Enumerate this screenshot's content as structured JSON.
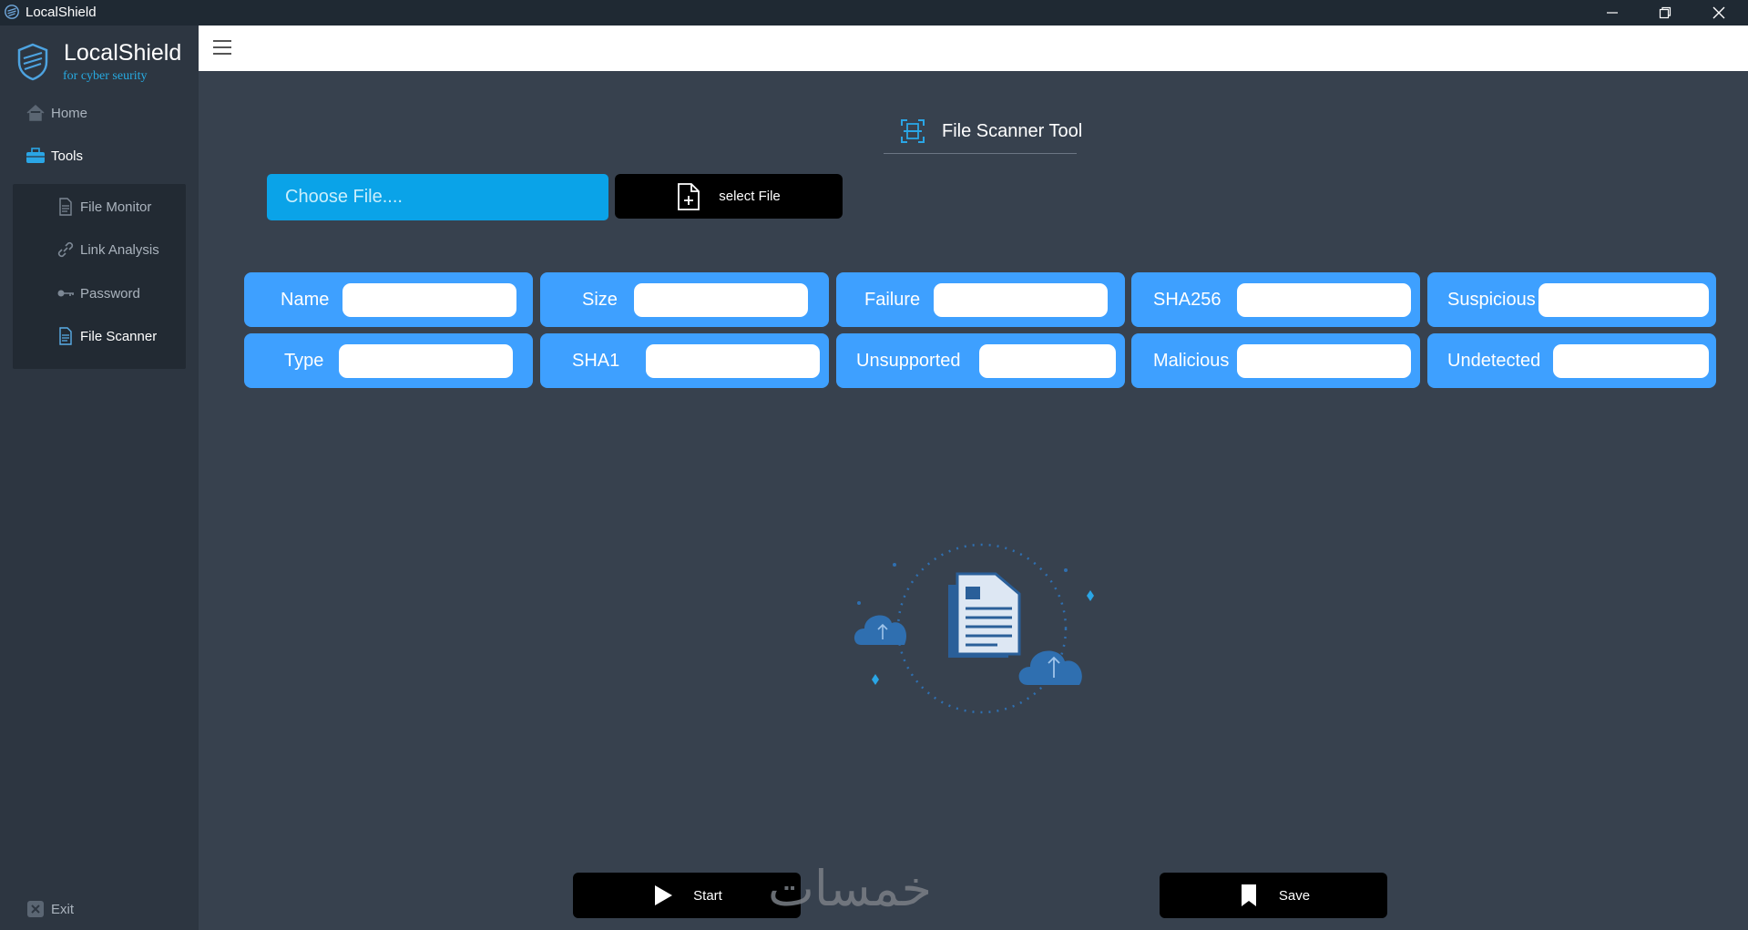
{
  "window": {
    "title": "LocalShield"
  },
  "sidebar": {
    "brand": "LocalShield",
    "tagline": "for cyber seurity",
    "home": "Home",
    "tools": "Tools",
    "tools_items": [
      "File Monitor",
      "Link Analysis",
      "Password",
      "File Scanner"
    ],
    "active_item": "File Scanner",
    "exit": "Exit"
  },
  "main": {
    "title": "File Scanner Tool",
    "choose_placeholder": "Choose File....",
    "select_button": "select File",
    "fields": [
      {
        "label": "Name",
        "value": ""
      },
      {
        "label": "Size",
        "value": ""
      },
      {
        "label": "Failure",
        "value": ""
      },
      {
        "label": "SHA256",
        "value": ""
      },
      {
        "label": "Suspicious",
        "value": ""
      },
      {
        "label": "Type",
        "value": ""
      },
      {
        "label": "SHA1",
        "value": ""
      },
      {
        "label": "Unsupported",
        "value": ""
      },
      {
        "label": "Malicious",
        "value": ""
      },
      {
        "label": "Undetected",
        "value": ""
      }
    ],
    "start_button": "Start",
    "save_button": "Save",
    "watermark": "خمسات"
  },
  "colors": {
    "background": "#37414e",
    "sidebar": "#2d3641",
    "card": "#3ea0ff",
    "chooser": "#0aa3e8",
    "accent": "#27aae1"
  },
  "icons": {
    "home": "home-icon",
    "tools": "toolbox-icon",
    "file_monitor": "document-icon",
    "link_analysis": "link-icon",
    "password": "key-icon",
    "file_scanner": "document-icon",
    "exit": "close-box-icon",
    "select_file": "file-plus-icon",
    "start": "play-icon",
    "save": "bookmark-icon"
  }
}
